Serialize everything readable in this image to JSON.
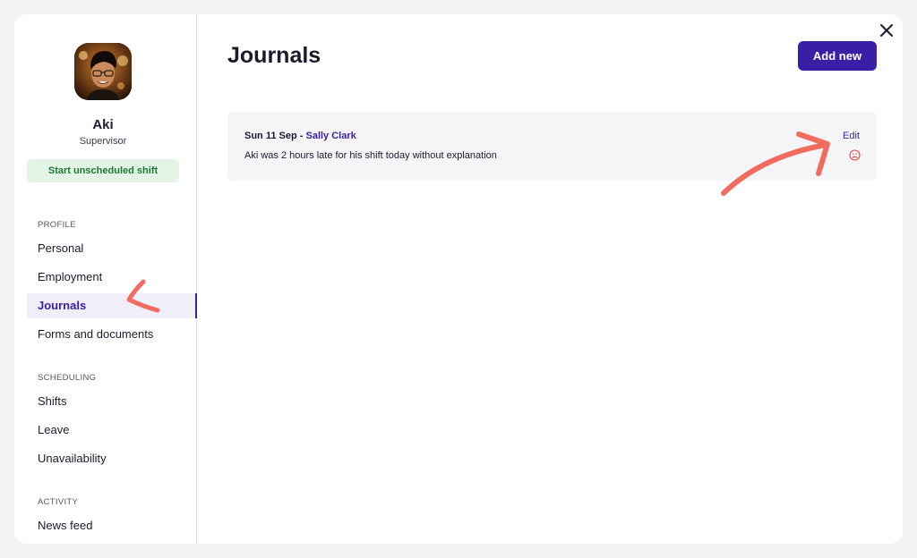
{
  "profile": {
    "name": "Aki",
    "role": "Supervisor",
    "shift_button": "Start unscheduled shift"
  },
  "sidebar": {
    "sections": [
      {
        "title": "PROFILE",
        "items": [
          "Personal",
          "Employment",
          "Journals",
          "Forms and documents"
        ]
      },
      {
        "title": "SCHEDULING",
        "items": [
          "Shifts",
          "Leave",
          "Unavailability"
        ]
      },
      {
        "title": "ACTIVITY",
        "items": [
          "News feed"
        ]
      }
    ],
    "active_item": "Journals"
  },
  "main": {
    "title": "Journals",
    "add_button": "Add new",
    "journals": [
      {
        "date": "Sun 11 Sep",
        "separator": " - ",
        "author": "Sally Clark",
        "text": "Aki was 2 hours late for his shift today without explanation",
        "edit_label": "Edit",
        "mood_icon": "sad-face-icon"
      }
    ]
  },
  "colors": {
    "accent": "#3a1fa6",
    "success_bg": "#e3f3e6",
    "success_text": "#1d7a35",
    "mood_sad": "#e5483f",
    "annotation": "#f26b5f"
  }
}
